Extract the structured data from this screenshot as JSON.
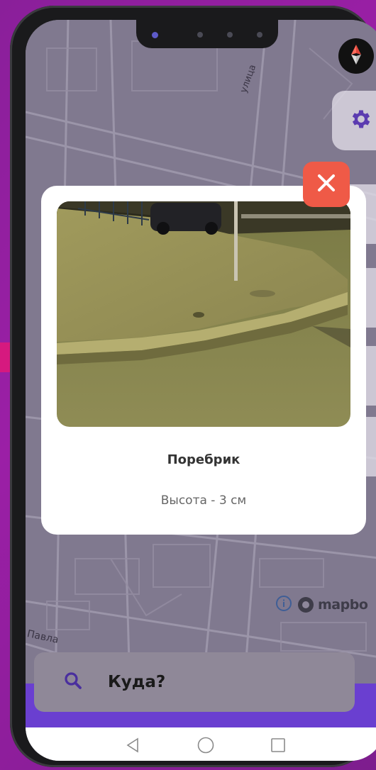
{
  "modal": {
    "title": "Поребрик",
    "description": "Высота - 3 см",
    "photo_subject": "curb-photo"
  },
  "search": {
    "label": "Куда?"
  },
  "map": {
    "street_labels": [
      "Павла",
      "улица"
    ],
    "attribution": "mapbo"
  },
  "colors": {
    "background": "#9b1fa6",
    "accent_purple": "#6a3fd0",
    "close_red": "#ef5a47",
    "icon_purple": "#5b3bb0"
  },
  "icons": {
    "compass": "compass-icon",
    "settings": "gear-icon",
    "close": "close-icon",
    "search": "search-icon",
    "info": "info-icon",
    "nav_back": "back-icon",
    "nav_home": "home-icon",
    "nav_recent": "recent-apps-icon"
  }
}
